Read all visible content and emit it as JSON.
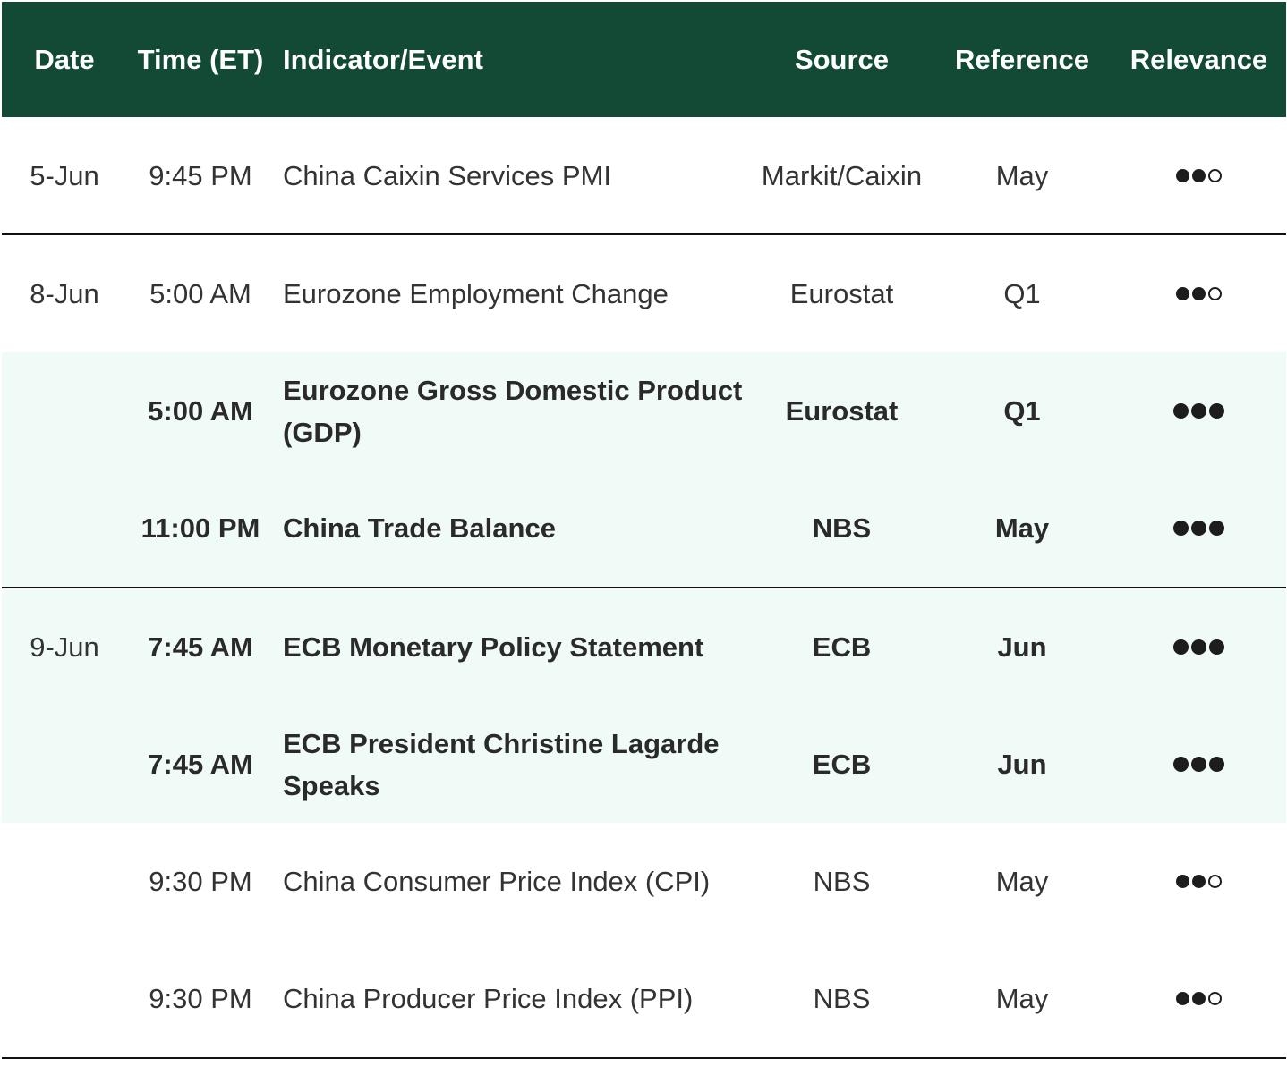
{
  "headers": {
    "date": "Date",
    "time": "Time (ET)",
    "event": "Indicator/Event",
    "source": "Source",
    "reference": "Reference",
    "relevance": "Relevance"
  },
  "rows": [
    {
      "date": "5-Jun",
      "time": "9:45 PM",
      "event": "China Caixin Services PMI",
      "source": "Markit/Caixin",
      "reference": "May",
      "relevance": 2,
      "bold": false,
      "highlight": false
    },
    {
      "date": "8-Jun",
      "time": "5:00 AM",
      "event": "Eurozone Employment Change",
      "source": "Eurostat",
      "reference": "Q1",
      "relevance": 2,
      "bold": false,
      "highlight": false
    },
    {
      "date": "",
      "time": "5:00 AM",
      "event": "Eurozone Gross Domestic Product (GDP)",
      "source": "Eurostat",
      "reference": "Q1",
      "relevance": 3,
      "bold": true,
      "highlight": true
    },
    {
      "date": "",
      "time": "11:00 PM",
      "event": "China Trade Balance",
      "source": "NBS",
      "reference": "May",
      "relevance": 3,
      "bold": true,
      "highlight": true
    },
    {
      "date": "9-Jun",
      "time": "7:45 AM",
      "event": "ECB Monetary Policy Statement",
      "source": "ECB",
      "reference": "Jun",
      "relevance": 3,
      "bold": true,
      "highlight": true
    },
    {
      "date": "",
      "time": "7:45 AM",
      "event": "ECB President Christine Lagarde Speaks",
      "source": "ECB",
      "reference": "Jun",
      "relevance": 3,
      "bold": true,
      "highlight": true
    },
    {
      "date": "",
      "time": "9:30 PM",
      "event": "China Consumer Price Index (CPI)",
      "source": "NBS",
      "reference": "May",
      "relevance": 2,
      "bold": false,
      "highlight": false
    },
    {
      "date": "",
      "time": "9:30 PM",
      "event": "China Producer Price Index (PPI)",
      "source": "NBS",
      "reference": "May",
      "relevance": 2,
      "bold": false,
      "highlight": false
    }
  ],
  "relevance_max": 3,
  "colors": {
    "header_bg": "#124a35",
    "highlight_bg": "#f0fbf7",
    "text": "#333333"
  }
}
